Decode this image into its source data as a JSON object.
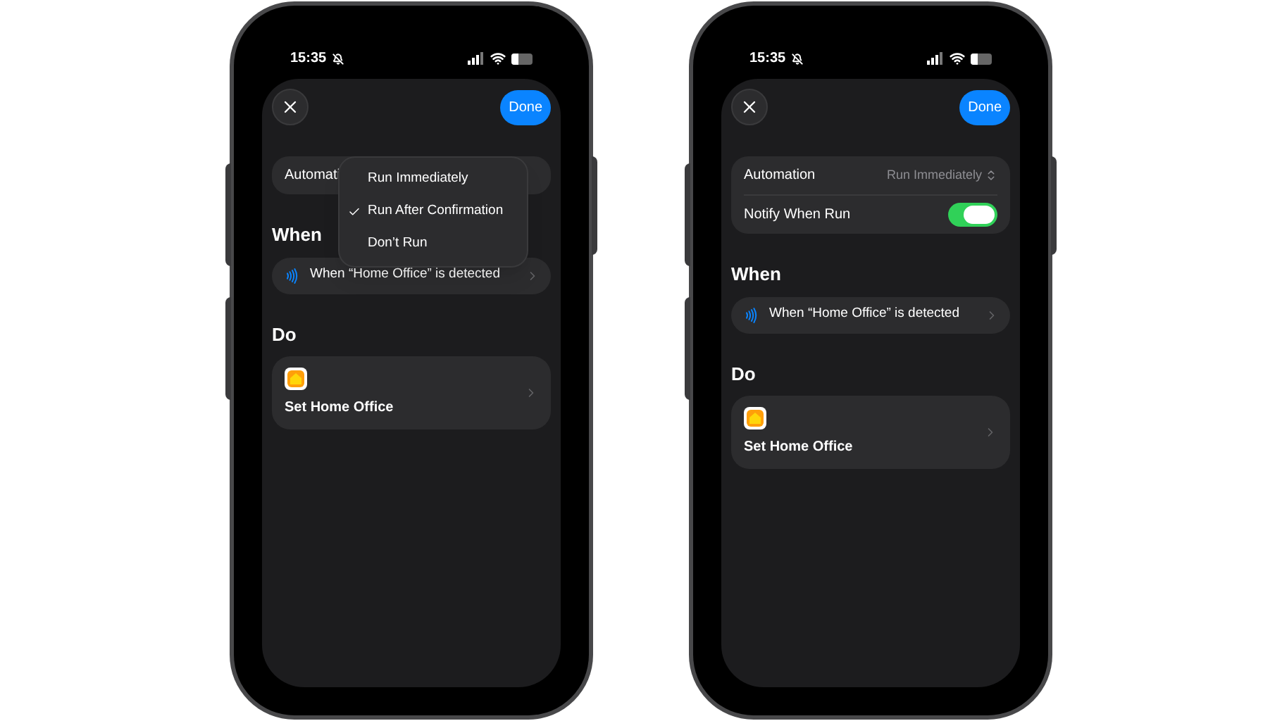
{
  "phones": [
    {
      "status_bar": {
        "time": "15:35"
      },
      "header": {
        "done": "Done"
      },
      "settings": [
        {
          "kind": "picker",
          "label": "Automati"
        }
      ],
      "menu": {
        "items": [
          {
            "label": "Run Immediately",
            "selected": false
          },
          {
            "label": "Run After Confirmation",
            "selected": true
          },
          {
            "label": "Don’t Run",
            "selected": false
          }
        ]
      },
      "when": {
        "title": "When",
        "trigger": "When “Home Office” is detected"
      },
      "do": {
        "title": "Do",
        "action": "Set Home Office"
      }
    },
    {
      "status_bar": {
        "time": "15:35"
      },
      "header": {
        "done": "Done"
      },
      "settings": [
        {
          "kind": "picker",
          "label": "Automation",
          "value": "Run Immediately"
        },
        {
          "kind": "toggle",
          "label": "Notify When Run",
          "on": true
        }
      ],
      "when": {
        "title": "When",
        "trigger": "When “Home Office” is detected"
      },
      "do": {
        "title": "Do",
        "action": "Set Home Office"
      }
    }
  ]
}
